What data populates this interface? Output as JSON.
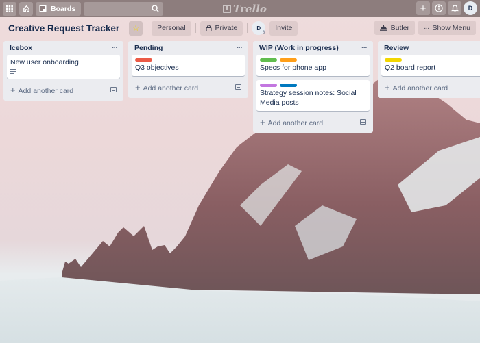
{
  "topbar": {
    "apps_icon": "grid-icon",
    "home_icon": "home-icon",
    "boards_label": "Boards",
    "search_placeholder": "",
    "logo_text": "Trello",
    "add_icon": "plus-icon",
    "info_icon": "info-icon",
    "notifications_icon": "bell-icon",
    "user_initial": "D"
  },
  "header": {
    "board_title": "Creative Request Tracker",
    "star_icon": "star-icon",
    "team_label": "Personal",
    "visibility_label": "Private",
    "member_initial": "D",
    "invite_label": "Invite",
    "butler_label": "Butler",
    "show_menu_label": "Show Menu"
  },
  "colors": {
    "topbar": "#8d7d7d",
    "list_bg": "#ebecf0",
    "label_red": "#eb5a46",
    "label_green": "#61bd4f",
    "label_orange": "#ff9f1a",
    "label_purple": "#c377e0",
    "label_blue": "#0079bf",
    "label_yellow": "#f2d600"
  },
  "lists": [
    {
      "title": "Icebox",
      "cards": [
        {
          "title": "New user onboarding",
          "labels": [],
          "has_description": true
        }
      ],
      "add_label": "Add another card"
    },
    {
      "title": "Pending",
      "cards": [
        {
          "title": "Q3 objectives",
          "labels": [
            "#eb5a46"
          ],
          "has_description": false
        }
      ],
      "add_label": "Add another card"
    },
    {
      "title": "WIP (Work in progress)",
      "cards": [
        {
          "title": "Specs for phone app",
          "labels": [
            "#61bd4f",
            "#ff9f1a"
          ],
          "has_description": false
        },
        {
          "title": "Strategy session notes: Social Media posts",
          "labels": [
            "#c377e0",
            "#0079bf"
          ],
          "has_description": false
        }
      ],
      "add_label": "Add another card"
    },
    {
      "title": "Review",
      "cards": [
        {
          "title": "Q2 board report",
          "labels": [
            "#f2d600"
          ],
          "has_description": false
        }
      ],
      "add_label": "Add another card"
    }
  ]
}
